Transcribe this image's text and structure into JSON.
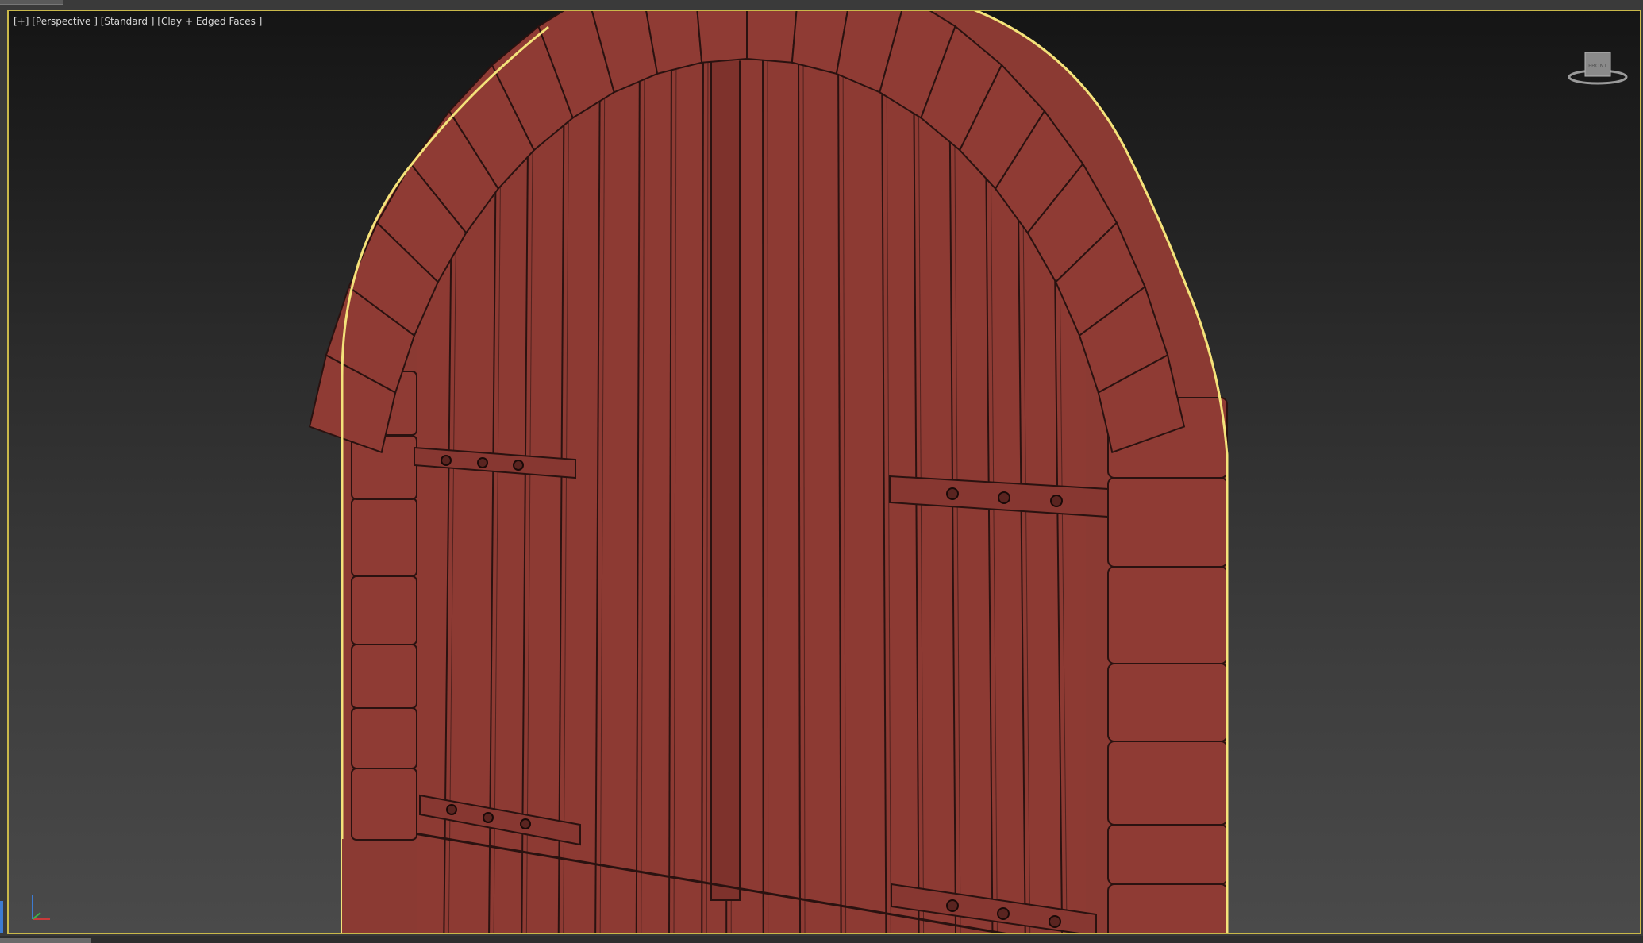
{
  "viewport": {
    "label": "[+] [Perspective ] [Standard ] [Clay + Edged Faces ]",
    "navcube_label": "FRONT"
  },
  "colors": {
    "clay": "#8b3a33",
    "clay_dark": "#6f2b25",
    "edge": "#2a1210",
    "selection": "#f4e27a",
    "viewport_border": "#c9b84a"
  },
  "icons": {
    "navcube": "view-cube-icon",
    "axis": "axis-tripod-icon"
  }
}
